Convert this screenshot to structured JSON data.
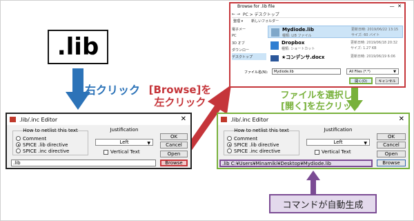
{
  "lib_label": ".lib",
  "right_click_label": "右クリック",
  "browse_instruction": {
    "line1": "[Browse]を",
    "line2": "左クリック"
  },
  "select_instruction": {
    "line1": "ファイルを選択し、",
    "line2": "[開く]を左クリック"
  },
  "auto_command_label": "コマンドが自動生成",
  "colors": {
    "blue": "#2c73b8",
    "red": "#c5353a",
    "green": "#78b13b",
    "purple": "#7b4b94"
  },
  "dialog_left": {
    "title": ".lib/.inc Editor",
    "netlist_group": "How to netlist this text",
    "options": [
      "Comment",
      "SPICE .lib directive",
      "SPICE .inc directive"
    ],
    "justification_group": "Justification",
    "justification_value": "Left",
    "vertical_text": "Vertical Text",
    "buttons": {
      "ok": "OK",
      "cancel": "Cancel",
      "open": "Open",
      "browse": "Browse"
    },
    "input_value": ".lib"
  },
  "dialog_right": {
    "title": ".lib/.inc Editor",
    "netlist_group": "How to netlist this text",
    "options": [
      "Comment",
      "SPICE .lib directive",
      "SPICE .inc directive"
    ],
    "justification_group": "Justification",
    "justification_value": "Left",
    "vertical_text": "Vertical Text",
    "buttons": {
      "ok": "OK",
      "cancel": "Cancel",
      "open": "Open",
      "browse": "Browse"
    },
    "input_value": ".lib C:¥Users¥Minamiki¥Desktop¥Mydiode.lib"
  },
  "file_browser": {
    "title": "Browse for .lib file",
    "address": "PC > デスクトップ",
    "toolbar": [
      "整理 ▾",
      "新しいフォルダー"
    ],
    "sidebar": [
      "電子メー",
      "PC",
      "3D オブ",
      "ダウンロー",
      "デスクトップ"
    ],
    "files": [
      {
        "name": "Mydiode.lib",
        "type": "種類: LIB ファイル",
        "date": "更新日時: 2019/06/22 13:15",
        "size": "サイズ: 60 バイト"
      },
      {
        "name": "Dropbox",
        "type": "種類: ショートカット",
        "date": "更新日時: 2019/06/18 20:32",
        "size": "サイズ: 1.27 KB"
      },
      {
        "name": "★コンデンサ.docx",
        "type": "",
        "date": "更新日時: 2019/06/19 6:06",
        "size": ""
      }
    ],
    "filename_label": "ファイル名(N):",
    "filename_value": "Mydiode.lib",
    "filter": "All Files (*.*)",
    "open_button": "開く(O)",
    "cancel_button": "キャンセル"
  }
}
